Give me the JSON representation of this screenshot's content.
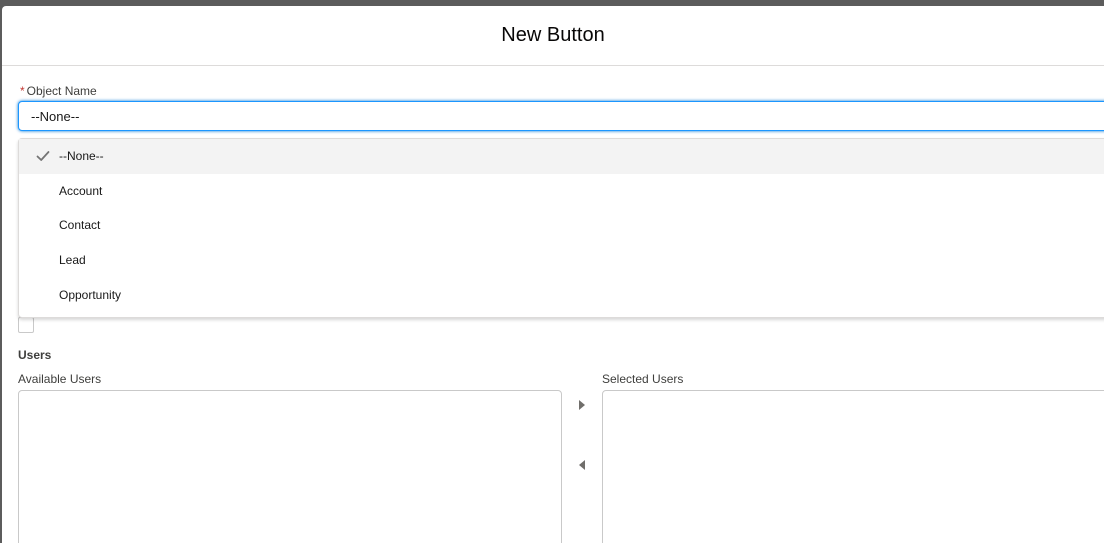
{
  "modal": {
    "title": "New Button"
  },
  "object_field": {
    "required_marker": "*",
    "label": "Object Name",
    "value": "--None--",
    "options": [
      {
        "label": "--None--",
        "selected": true
      },
      {
        "label": "Account",
        "selected": false
      },
      {
        "label": "Contact",
        "selected": false
      },
      {
        "label": "Lead",
        "selected": false
      },
      {
        "label": "Opportunity",
        "selected": false
      }
    ]
  },
  "users": {
    "section_title": "Users",
    "available_label": "Available Users",
    "selected_label": "Selected Users",
    "move_right_icon": "triangle-right-icon",
    "move_left_icon": "triangle-left-icon"
  },
  "colors": {
    "focus_border": "#1b96ff",
    "required": "#c23934",
    "selected_option_bg": "#f3f3f3",
    "backdrop": "#5c5c5c"
  }
}
